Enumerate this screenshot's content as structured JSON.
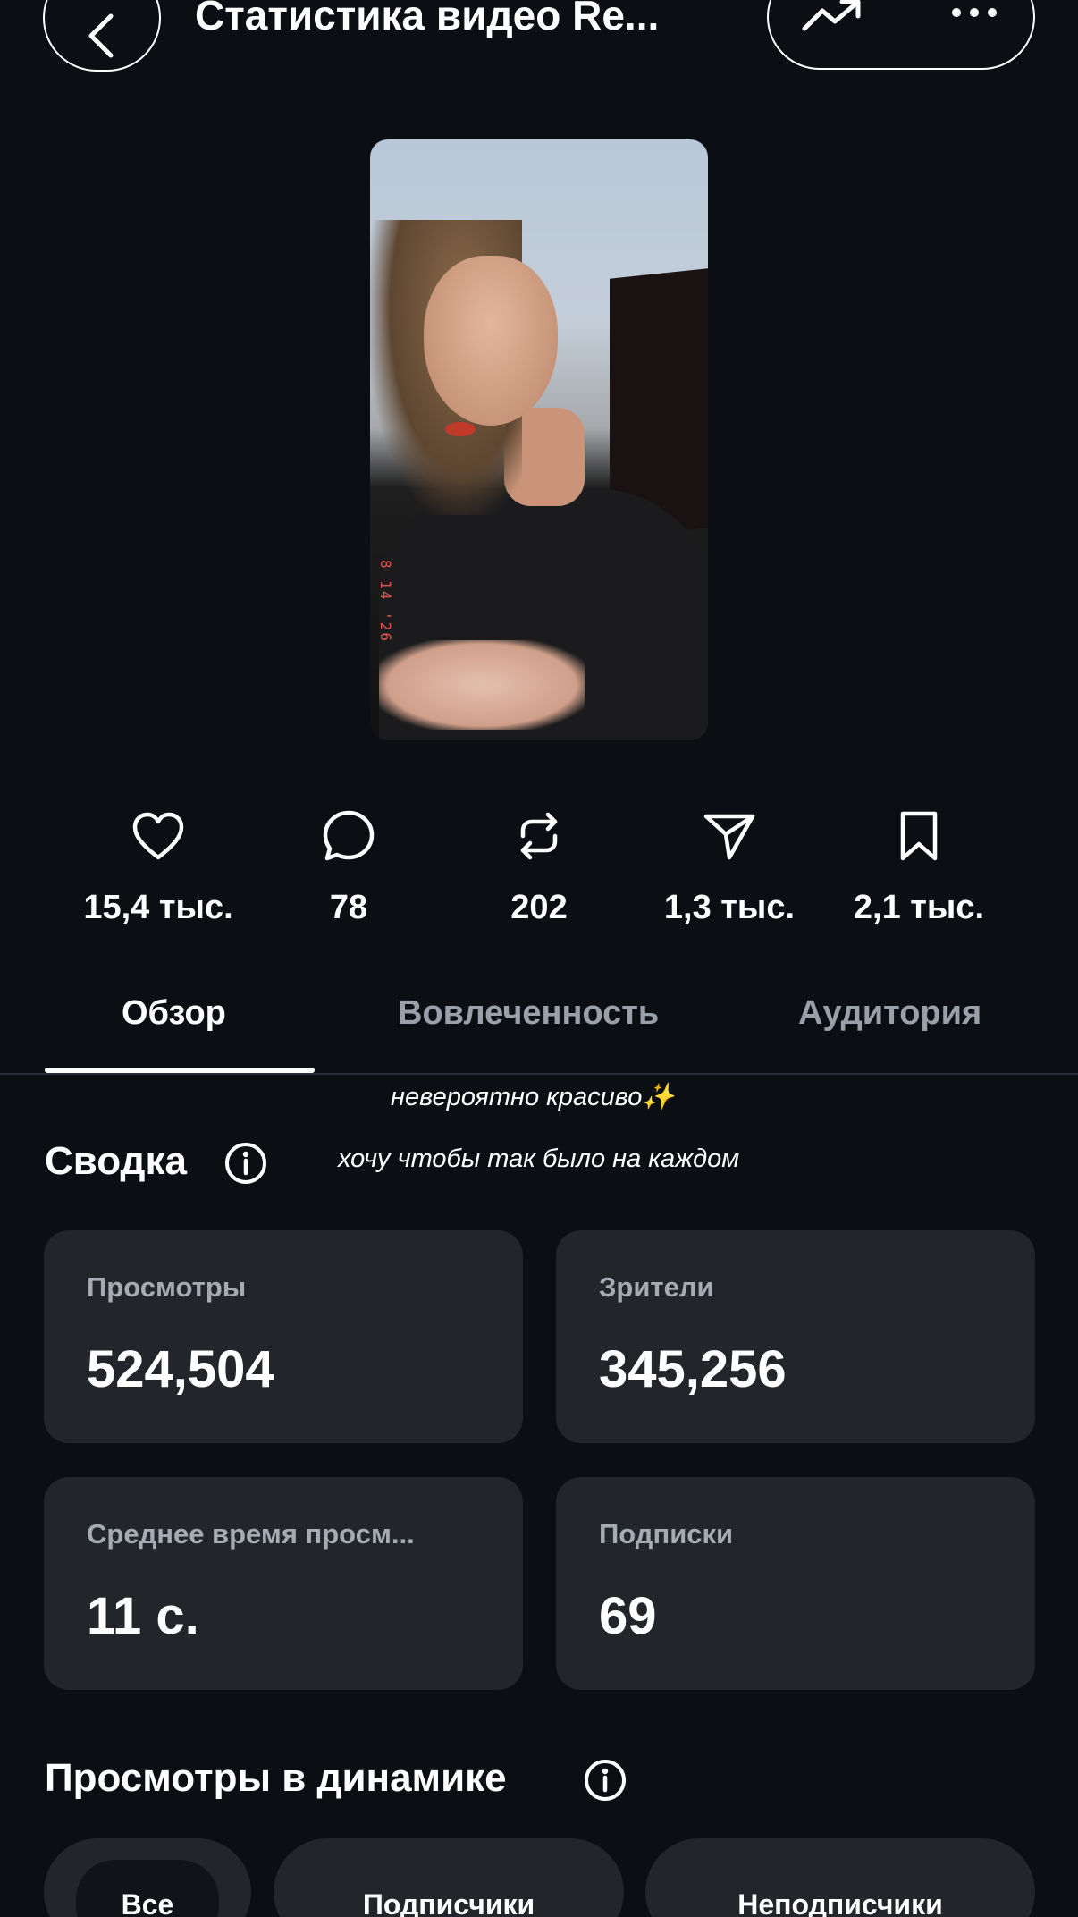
{
  "header": {
    "title": "Статистика видео Re...",
    "back_icon": "chevron-left-icon",
    "trend_icon": "trending-up-icon",
    "more_icon": "more-horizontal-icon"
  },
  "video": {
    "stamp_text": "8 14 '26"
  },
  "stats": [
    {
      "icon": "heart-icon",
      "value": "15,4 тыс."
    },
    {
      "icon": "comment-icon",
      "value": "78"
    },
    {
      "icon": "repost-icon",
      "value": "202"
    },
    {
      "icon": "send-icon",
      "value": "1,3 тыс."
    },
    {
      "icon": "bookmark-icon",
      "value": "2,1 тыс."
    }
  ],
  "tabs": [
    {
      "label": "Обзор",
      "active": true
    },
    {
      "label": "Вовлеченность",
      "active": false
    },
    {
      "label": "Аудитория",
      "active": false
    }
  ],
  "overlay_captions": [
    "невероятно красиво✨",
    "хочу чтобы так было на каждом"
  ],
  "summary": {
    "title": "Сводка",
    "cards": [
      {
        "label": "Просмотры",
        "value": "524,504"
      },
      {
        "label": "Зрители",
        "value": "345,256"
      },
      {
        "label": "Среднее время просм...",
        "value": "11 с."
      },
      {
        "label": "Подписки",
        "value": "69"
      }
    ]
  },
  "dynamics": {
    "title": "Просмотры в динамике",
    "filters": [
      {
        "label": "Все",
        "selected": true
      },
      {
        "label": "Подписчики",
        "selected": false
      },
      {
        "label": "Неподписчики",
        "selected": false
      }
    ]
  },
  "colors": {
    "background": "#0b0f14",
    "card": "#22262b",
    "muted_text": "#a6abb3",
    "text": "#ffffff"
  }
}
